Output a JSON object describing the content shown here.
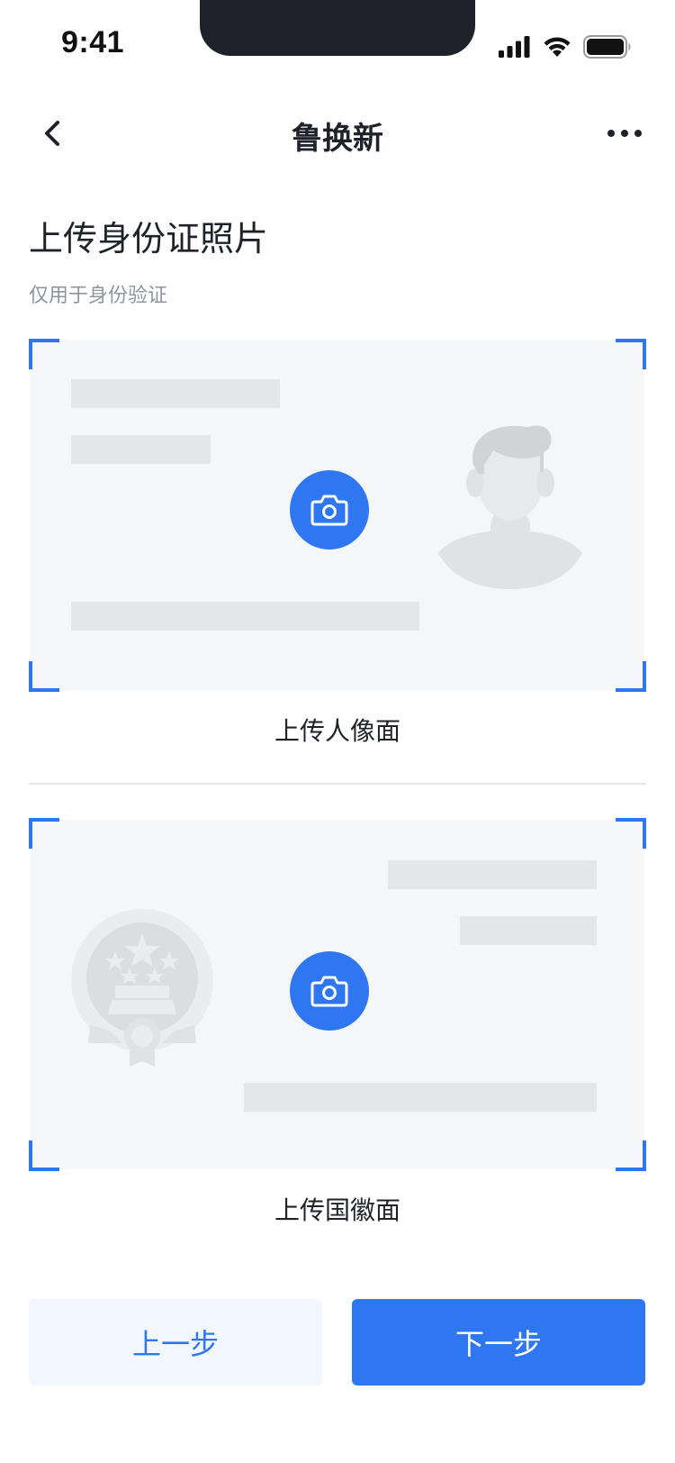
{
  "status_bar": {
    "time": "9:41"
  },
  "nav": {
    "title": "鲁换新"
  },
  "page": {
    "heading": "上传身份证照片",
    "subheading": "仅用于身份验证"
  },
  "cards": [
    {
      "caption": "上传人像面",
      "illustration": "portrait-silhouette"
    },
    {
      "caption": "上传国徽面",
      "illustration": "national-emblem"
    }
  ],
  "buttons": {
    "prev_label": "上一步",
    "next_label": "下一步"
  },
  "colors": {
    "accent": "#2e77f0",
    "card_background": "#f5f6f8",
    "placeholder_bar": "#e4e6ea",
    "secondary_text": "#8f959e",
    "prev_button_background": "#f2f6fd"
  }
}
